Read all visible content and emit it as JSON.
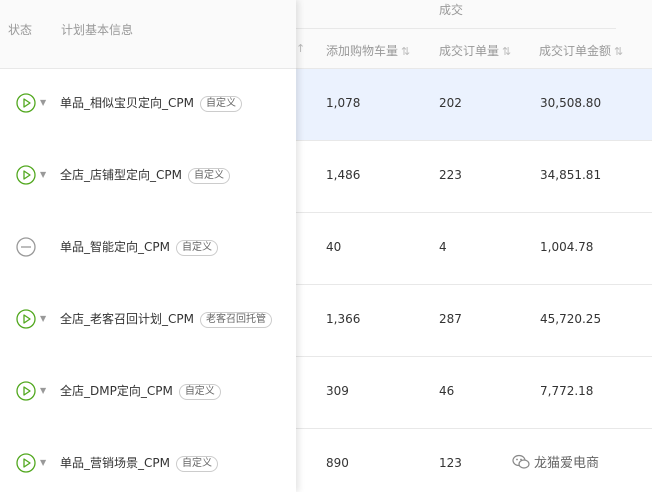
{
  "header": {
    "status_label": "状态",
    "plan_info_label": "计划基本信息",
    "group_label": "成交",
    "columns": [
      "添加购物车量",
      "成交订单量",
      "成交订单金额"
    ],
    "sort_glyph": "⇅"
  },
  "rows": [
    {
      "status": "play",
      "name": "单品_相似宝贝定向_CPM",
      "tag": "自定义",
      "cart": "1,078",
      "orders": "202",
      "amount": "30,508.80",
      "selected": true
    },
    {
      "status": "play",
      "name": "全店_店铺型定向_CPM",
      "tag": "自定义",
      "cart": "1,486",
      "orders": "223",
      "amount": "34,851.81",
      "selected": false
    },
    {
      "status": "paused",
      "name": "单品_智能定向_CPM",
      "tag": "自定义",
      "cart": "40",
      "orders": "4",
      "amount": "1,004.78",
      "selected": false
    },
    {
      "status": "play",
      "name": "全店_老客召回计划_CPM",
      "tag": "老客召回托管",
      "cart": "1,366",
      "orders": "287",
      "amount": "45,720.25",
      "selected": false
    },
    {
      "status": "play",
      "name": "全店_DMP定向_CPM",
      "tag": "自定义",
      "cart": "309",
      "orders": "46",
      "amount": "7,772.18",
      "selected": false
    },
    {
      "status": "play",
      "name": "单品_营销场景_CPM",
      "tag": "自定义",
      "cart": "890",
      "orders": "123",
      "amount": "",
      "selected": false
    }
  ],
  "watermark": {
    "text": "龙猫爱电商",
    "icon": "wechat-icon"
  },
  "colors": {
    "status_active": "#52a81f",
    "status_paused": "#999999",
    "selected_row": "#ebf2fe"
  }
}
